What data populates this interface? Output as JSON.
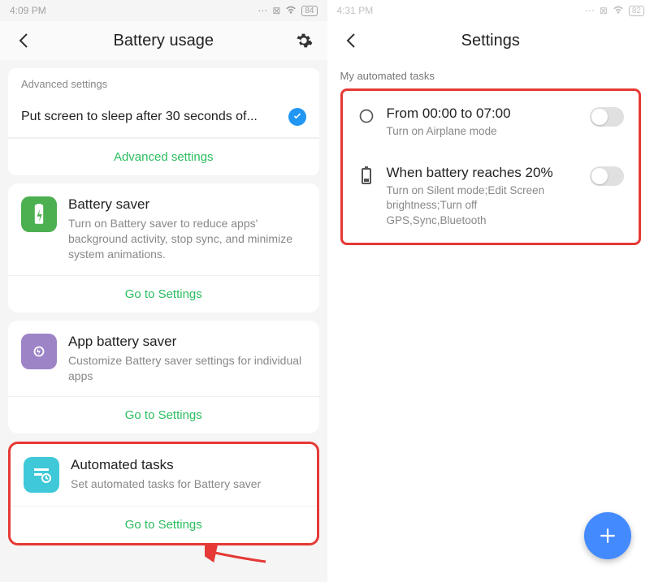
{
  "left": {
    "status_time": "4:09 PM",
    "battery": "84",
    "nav_title": "Battery  usage",
    "advanced_header": "Advanced settings",
    "sleep_row": "Put screen to sleep after 30 seconds of...",
    "advanced_link": "Advanced settings",
    "cards": [
      {
        "title": "Battery saver",
        "desc": "Turn on Battery saver to reduce apps' background activity, stop sync, and minimize system animations.",
        "link": "Go to Settings"
      },
      {
        "title": "App battery saver",
        "desc": "Customize Battery saver settings for individual apps",
        "link": "Go to Settings"
      },
      {
        "title": "Automated tasks",
        "desc": "Set automated tasks for Battery saver",
        "link": "Go to Settings"
      }
    ]
  },
  "right": {
    "status_time": "4:31 PM",
    "battery": "82",
    "nav_title": "Settings",
    "section": "My automated tasks",
    "tasks": [
      {
        "title": "From 00:00 to 07:00",
        "desc": "Turn on Airplane mode"
      },
      {
        "title": "When battery reaches 20%",
        "desc": "Turn on Silent mode;Edit Screen brightness;Turn off GPS,Sync,Bluetooth"
      }
    ]
  }
}
